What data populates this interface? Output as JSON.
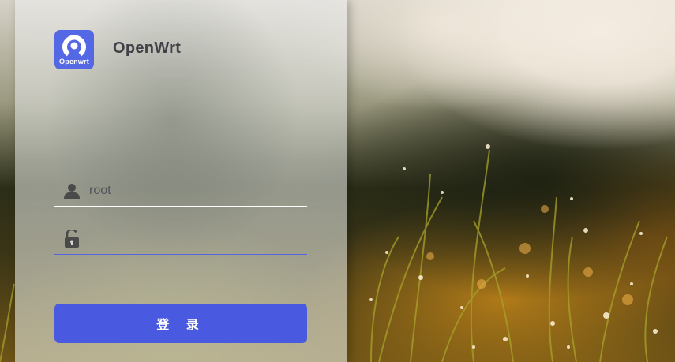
{
  "brand": {
    "logo_caption": "Openwrt",
    "name": "OpenWrt",
    "logo_color": "#5468e6"
  },
  "form": {
    "username_value": "root",
    "password_value": "",
    "submit_label": "登 录"
  },
  "colors": {
    "accent": "#4a5ae0"
  },
  "icons": {
    "username": "user-icon",
    "password": "unlock-icon"
  }
}
